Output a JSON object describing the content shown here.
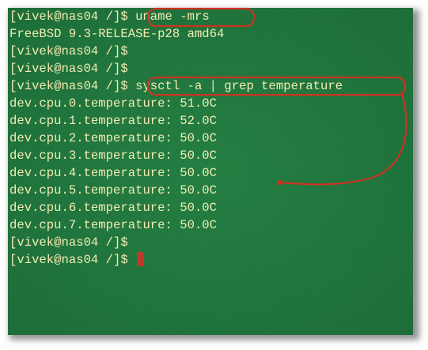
{
  "terminal": {
    "lines": [
      {
        "prompt": "[vivek@nas04 /]$",
        "command": "uname -mrs"
      },
      {
        "text": "FreeBSD 9.3-RELEASE-p28 amd64"
      },
      {
        "prompt": "[vivek@nas04 /]$",
        "command": ""
      },
      {
        "prompt": "[vivek@nas04 /]$",
        "command": ""
      },
      {
        "prompt": "[vivek@nas04 /]$",
        "command": "sysctl -a | grep temperature"
      },
      {
        "text": "dev.cpu.0.temperature: 51.0C"
      },
      {
        "text": "dev.cpu.1.temperature: 52.0C"
      },
      {
        "text": "dev.cpu.2.temperature: 50.0C"
      },
      {
        "text": "dev.cpu.3.temperature: 50.0C"
      },
      {
        "text": "dev.cpu.4.temperature: 50.0C"
      },
      {
        "text": "dev.cpu.5.temperature: 50.0C"
      },
      {
        "text": "dev.cpu.6.temperature: 50.0C"
      },
      {
        "text": "dev.cpu.7.temperature: 50.0C"
      },
      {
        "prompt": "[vivek@nas04 /]$",
        "command": ""
      },
      {
        "prompt": "[vivek@nas04 /]$",
        "command": "",
        "cursor": true
      }
    ]
  },
  "colors": {
    "background": "#217a3f",
    "text": "#f2ecb4",
    "annotation": "#cc3322",
    "cursor": "#c0392b"
  }
}
